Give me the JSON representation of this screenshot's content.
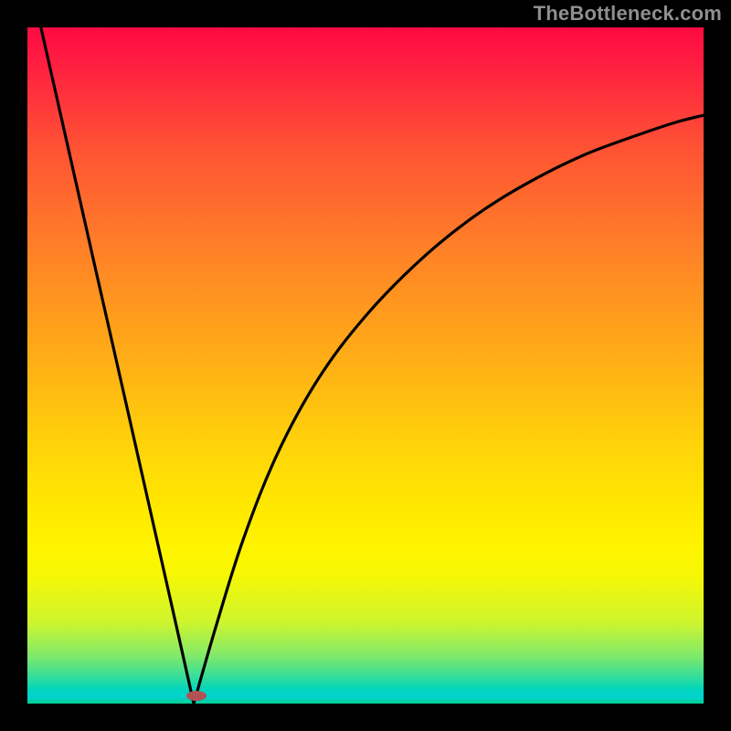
{
  "watermark": "TheBottleneck.com",
  "chart_data": {
    "type": "line",
    "title": "",
    "xlabel": "",
    "ylabel": "",
    "xlim": [
      0,
      1
    ],
    "ylim": [
      0,
      1
    ],
    "grid": false,
    "legend": false,
    "note": "Axes are unlabeled; values are normalized 0–1 within the plot box. Curve is a V-shape: linear descent from (≈0.02,1.0) to minimum at (≈0.246,0.0), then a concave rise toward (1.0,≈0.87).",
    "series": [
      {
        "name": "curve",
        "x": [
          0.02,
          0.06,
          0.1,
          0.14,
          0.18,
          0.22,
          0.246,
          0.28,
          0.32,
          0.37,
          0.43,
          0.5,
          0.58,
          0.66,
          0.74,
          0.82,
          0.9,
          0.96,
          1.0
        ],
        "y": [
          1.0,
          0.823,
          0.646,
          0.47,
          0.293,
          0.116,
          0.0,
          0.118,
          0.245,
          0.37,
          0.48,
          0.573,
          0.655,
          0.72,
          0.77,
          0.81,
          0.84,
          0.86,
          0.87
        ]
      }
    ],
    "marker": {
      "x": 0.246,
      "y": 0.0,
      "shape": "oval",
      "color": "#b15255"
    }
  }
}
